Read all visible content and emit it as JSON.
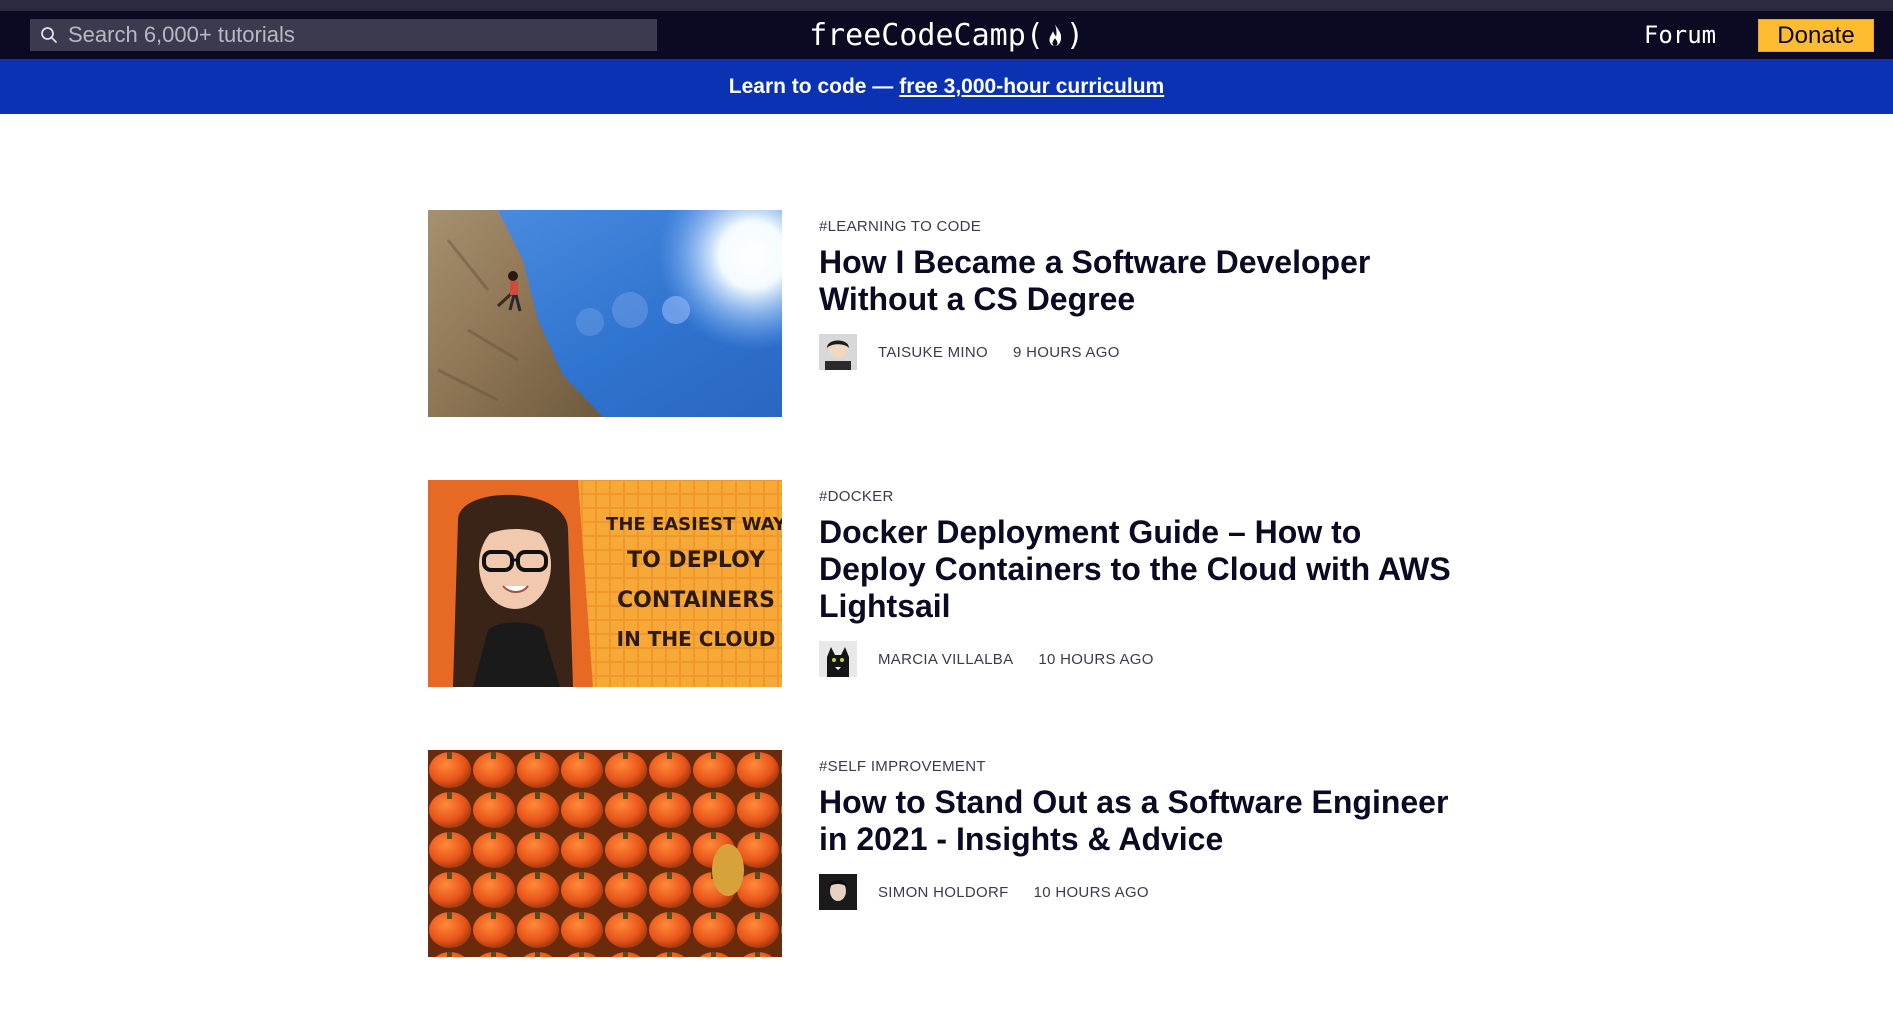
{
  "nav": {
    "search_placeholder": "Search 6,000+ tutorials",
    "logo_text": "freeCodeCamp",
    "logo_paren_open": "(",
    "logo_paren_close": ")",
    "forum_label": "Forum",
    "donate_label": "Donate"
  },
  "banner": {
    "prefix": "Learn to code —",
    "link_text": "free 3,000-hour curriculum"
  },
  "posts": [
    {
      "tag": "#LEARNING TO CODE",
      "title": "How I Became a Software Developer Without a CS Degree",
      "author": "TAISUKE MINO",
      "time": "9 HOURS AGO"
    },
    {
      "tag": "#DOCKER",
      "title": "Docker Deployment Guide – How to Deploy Containers to the Cloud with AWS Lightsail",
      "author": "MARCIA VILLALBA",
      "time": "10 HOURS AGO",
      "thumb_text": [
        "THE EASIEST WAY",
        "TO DEPLOY",
        "CONTAINERS",
        "IN THE CLOUD"
      ]
    },
    {
      "tag": "#SELF IMPROVEMENT",
      "title": "How to Stand Out as a Software Engineer in 2021 - Insights & Advice",
      "author": "SIMON HOLDORF",
      "time": "10 HOURS AGO"
    }
  ],
  "colors": {
    "nav_bg": "#0a0a23",
    "banner_bg": "#0b32b3",
    "donate_bg": "#febc30",
    "search_bg": "#3b3b4f"
  }
}
